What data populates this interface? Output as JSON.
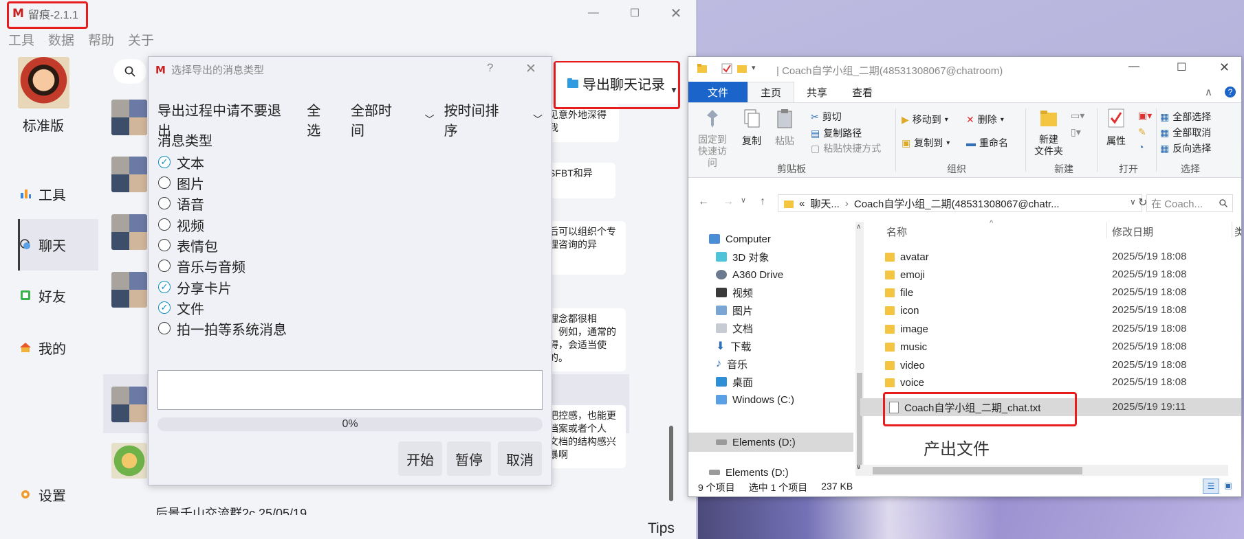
{
  "app": {
    "title": "留痕-2.1.1",
    "menu": [
      "工具",
      "数据",
      "帮助",
      "关于"
    ],
    "edition": "标准版",
    "nav": [
      "工具",
      "聊天",
      "好友",
      "我的",
      "设置"
    ],
    "export_button": "导出聊天记录",
    "tips": "Tips",
    "chat_snippets": [
      "见意外地深得我",
      "SFBT和异",
      "后可以组织个专\n理咨询的异",
      "理念都很相\n，例如，通常的\n碍，会适当使\n的。",
      "把控感，也能更\n档案或者个人\n文档的结构感兴\n暴啊"
    ],
    "partial_row": "后景千山交流群2c 25/05/19"
  },
  "dialog": {
    "title": "选择导出的消息类型",
    "help": "?",
    "warning": "导出过程中请不要退出",
    "select_all": "全选",
    "time_range": "全部时间",
    "sort": "按时间排序",
    "section_label": "消息类型",
    "options": [
      {
        "label": "文本",
        "checked": true
      },
      {
        "label": "图片",
        "checked": false
      },
      {
        "label": "语音",
        "checked": false
      },
      {
        "label": "视频",
        "checked": false
      },
      {
        "label": "表情包",
        "checked": false
      },
      {
        "label": "音乐与音频",
        "checked": false
      },
      {
        "label": "分享卡片",
        "checked": true
      },
      {
        "label": "文件",
        "checked": true
      },
      {
        "label": "拍一拍等系统消息",
        "checked": false
      }
    ],
    "progress": "0%",
    "buttons": [
      "开始",
      "暂停",
      "取消"
    ]
  },
  "explorer": {
    "title": "Coach自学小组_二期(48531308067@chatroom)",
    "tabs": [
      "文件",
      "主页",
      "共享",
      "查看"
    ],
    "ribbon": {
      "pin": "固定到\n快速访问",
      "copy": "复制",
      "paste": "粘贴",
      "cut": "剪切",
      "copy_path": "复制路径",
      "paste_shortcut": "粘贴快捷方式",
      "clipboard": "剪贴板",
      "move_to": "移动到",
      "delete": "删除",
      "copy_to": "复制到",
      "rename": "重命名",
      "organize": "组织",
      "new_folder": "新建\n文件夹",
      "new": "新建",
      "properties": "属性",
      "open": "打开",
      "select_all": "全部选择",
      "select_none": "全部取消",
      "invert": "反向选择",
      "select": "选择"
    },
    "address": [
      "«",
      "聊天...",
      "Coach自学小组_二期(48531308067@chatr..."
    ],
    "search_placeholder": "在 Coach...",
    "tree": [
      "Computer",
      "3D 对象",
      "A360 Drive",
      "视频",
      "图片",
      "文档",
      "下载",
      "音乐",
      "桌面",
      "Windows (C:)",
      "Elements (D:)",
      "Elements (D:)"
    ],
    "columns": {
      "name": "名称",
      "date": "修改日期",
      "type": "类"
    },
    "files": [
      {
        "name": "avatar",
        "date": "2025/5/19 18:08",
        "kind": "folder"
      },
      {
        "name": "emoji",
        "date": "2025/5/19 18:08",
        "kind": "folder"
      },
      {
        "name": "file",
        "date": "2025/5/19 18:08",
        "kind": "folder"
      },
      {
        "name": "icon",
        "date": "2025/5/19 18:08",
        "kind": "folder"
      },
      {
        "name": "image",
        "date": "2025/5/19 18:08",
        "kind": "folder"
      },
      {
        "name": "music",
        "date": "2025/5/19 18:08",
        "kind": "folder"
      },
      {
        "name": "video",
        "date": "2025/5/19 18:08",
        "kind": "folder"
      },
      {
        "name": "voice",
        "date": "2025/5/19 18:08",
        "kind": "folder"
      },
      {
        "name": "Coach自学小组_二期_chat.txt",
        "date": "2025/5/19 19:11",
        "kind": "txt"
      }
    ],
    "output_label": "产出文件",
    "status": [
      "9 个项目",
      "选中 1 个项目",
      "237 KB"
    ]
  },
  "colors": {
    "highlight": "#e81c1c",
    "accent": "#0f8fc0",
    "file_tab": "#1b64c9"
  }
}
